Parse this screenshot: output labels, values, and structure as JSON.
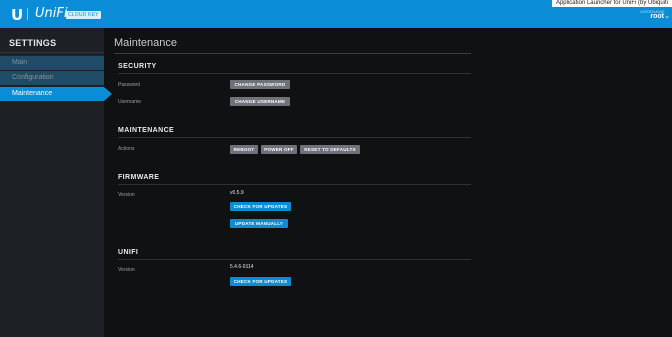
{
  "header": {
    "logo_mark": "U",
    "logo_text": "UniFi",
    "logo_badge": "CLOUD KEY",
    "tooltip": "Application Launcher for UniFi (by Ubiquiti",
    "user_label": "USERNAME",
    "user_name": "root"
  },
  "sidebar": {
    "title": "SETTINGS",
    "items": [
      {
        "label": "Main"
      },
      {
        "label": "Configuration"
      },
      {
        "label": "Maintenance"
      }
    ]
  },
  "page": {
    "title": "Maintenance",
    "security": {
      "heading": "SECURITY",
      "password_label": "Password",
      "change_password": "CHANGE PASSWORD",
      "username_label": "Username",
      "change_username": "CHANGE USERNAME"
    },
    "maintenance": {
      "heading": "MAINTENANCE",
      "actions_label": "Actions",
      "reboot": "REBOOT",
      "power_off": "POWER OFF",
      "reset": "RESET TO DEFAULTS"
    },
    "firmware": {
      "heading": "FIRMWARE",
      "version_label": "Version",
      "version": "v0.5.9",
      "check_updates": "CHECK FOR UPDATES",
      "update_manually": "UPDATE MANUALLY"
    },
    "unifi": {
      "heading": "UNIFI",
      "version_label": "Version",
      "version": "5.4.6-9114",
      "check_updates": "CHECK FOR UPDATES"
    }
  },
  "colors": {
    "accent": "#0a8cd6",
    "background": "#101113",
    "sidebar": "#1d2024",
    "button_gray": "#6d7378"
  }
}
